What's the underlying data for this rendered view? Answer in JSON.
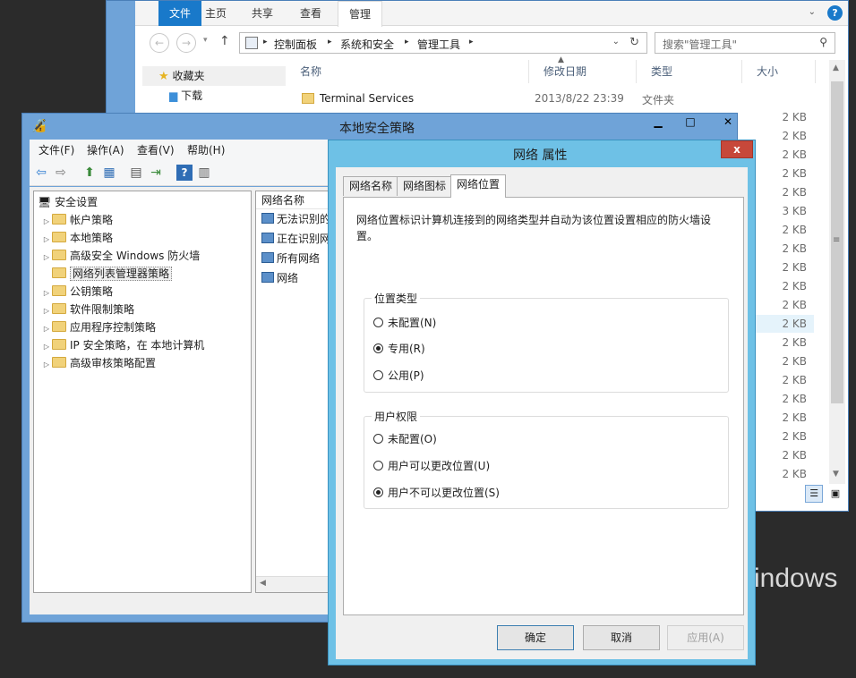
{
  "desktop": {
    "watermark": "indows"
  },
  "explorer": {
    "ribbon_tabs": [
      "文件",
      "主页",
      "共享",
      "查看",
      "管理"
    ],
    "address": {
      "crumbs": [
        "控制面板",
        "系统和安全",
        "管理工具"
      ]
    },
    "search_placeholder": "搜索\"管理工具\"",
    "nav_items": [
      "收藏夹",
      "下载"
    ],
    "columns": {
      "name": "名称",
      "date": "修改日期",
      "type": "类型",
      "size": "大小"
    },
    "first_file": {
      "name": "Terminal Services",
      "date": "2013/8/22 23:39",
      "type": "文件夹"
    },
    "sizes": [
      "2 KB",
      "2 KB",
      "2 KB",
      "2 KB",
      "2 KB",
      "3 KB",
      "2 KB",
      "2 KB",
      "2 KB",
      "2 KB",
      "2 KB",
      "2 KB",
      "2 KB",
      "2 KB",
      "2 KB",
      "2 KB",
      "2 KB",
      "2 KB",
      "2 KB",
      "2 KB"
    ],
    "selected_size_row": 11
  },
  "lsp": {
    "title": "本地安全策略",
    "menu": [
      "文件(F)",
      "操作(A)",
      "查看(V)",
      "帮助(H)"
    ],
    "tree_root": "安全设置",
    "tree_items": [
      "帐户策略",
      "本地策略",
      "高级安全 Windows 防火墙",
      "网络列表管理器策略",
      "公钥策略",
      "软件限制策略",
      "应用程序控制策略",
      "IP 安全策略，在 本地计算机",
      "高级审核策略配置"
    ],
    "selected_tree_index": 3,
    "list_header": "网络名称",
    "list_items": [
      "无法识别的",
      "正在识别网",
      "所有网络",
      "网络"
    ]
  },
  "dialog": {
    "title": "网络 属性",
    "close_glyph": "x",
    "tabs": [
      "网络名称",
      "网络图标",
      "网络位置"
    ],
    "active_tab": 2,
    "description": "网络位置标识计算机连接到的网络类型并自动为该位置设置相应的防火墙设置。",
    "location_group": {
      "label": "位置类型",
      "options": [
        "未配置(N)",
        "专用(R)",
        "公用(P)"
      ],
      "selected": 1
    },
    "permission_group": {
      "label": "用户权限",
      "options": [
        "未配置(O)",
        "用户可以更改位置(U)",
        "用户不可以更改位置(S)"
      ],
      "selected": 2
    },
    "buttons": {
      "ok": "确定",
      "cancel": "取消",
      "apply": "应用(A)"
    }
  }
}
